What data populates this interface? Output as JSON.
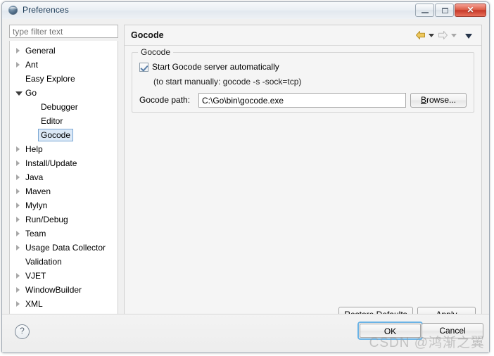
{
  "window": {
    "title": "Preferences",
    "icon": "preferences-globe-icon",
    "minimize_label": "",
    "maximize_label": "",
    "close_label": "✕"
  },
  "sidebar": {
    "filter": {
      "value": "",
      "placeholder": "type filter text"
    },
    "items": [
      {
        "label": "General",
        "level": 0,
        "expandable": true,
        "expanded": false,
        "selected": false
      },
      {
        "label": "Ant",
        "level": 0,
        "expandable": true,
        "expanded": false,
        "selected": false
      },
      {
        "label": "Easy Explore",
        "level": 0,
        "expandable": false,
        "expanded": false,
        "selected": false
      },
      {
        "label": "Go",
        "level": 0,
        "expandable": true,
        "expanded": true,
        "selected": false
      },
      {
        "label": "Debugger",
        "level": 1,
        "expandable": false,
        "expanded": false,
        "selected": false
      },
      {
        "label": "Editor",
        "level": 1,
        "expandable": false,
        "expanded": false,
        "selected": false
      },
      {
        "label": "Gocode",
        "level": 1,
        "expandable": false,
        "expanded": false,
        "selected": true
      },
      {
        "label": "Help",
        "level": 0,
        "expandable": true,
        "expanded": false,
        "selected": false
      },
      {
        "label": "Install/Update",
        "level": 0,
        "expandable": true,
        "expanded": false,
        "selected": false
      },
      {
        "label": "Java",
        "level": 0,
        "expandable": true,
        "expanded": false,
        "selected": false
      },
      {
        "label": "Maven",
        "level": 0,
        "expandable": true,
        "expanded": false,
        "selected": false
      },
      {
        "label": "Mylyn",
        "level": 0,
        "expandable": true,
        "expanded": false,
        "selected": false
      },
      {
        "label": "Run/Debug",
        "level": 0,
        "expandable": true,
        "expanded": false,
        "selected": false
      },
      {
        "label": "Team",
        "level": 0,
        "expandable": true,
        "expanded": false,
        "selected": false
      },
      {
        "label": "Usage Data Collector",
        "level": 0,
        "expandable": true,
        "expanded": false,
        "selected": false
      },
      {
        "label": "Validation",
        "level": 0,
        "expandable": false,
        "expanded": false,
        "selected": false
      },
      {
        "label": "VJET",
        "level": 0,
        "expandable": true,
        "expanded": false,
        "selected": false
      },
      {
        "label": "WindowBuilder",
        "level": 0,
        "expandable": true,
        "expanded": false,
        "selected": false
      },
      {
        "label": "XML",
        "level": 0,
        "expandable": true,
        "expanded": false,
        "selected": false
      }
    ]
  },
  "content": {
    "title": "Gocode",
    "nav": {
      "back_icon": "back-arrow-icon",
      "back_dropdown_icon": "chevron-down-icon",
      "forward_icon": "forward-arrow-icon",
      "forward_dropdown_icon": "chevron-down-icon",
      "menu_icon": "chevron-down-icon",
      "back_color": "#e8b84b",
      "forward_color": "#cfcfcf"
    },
    "group": {
      "legend": "Gocode",
      "checkbox": {
        "label": "Start Gocode server automatically",
        "checked": true
      },
      "hint": "(to start manually: gocode -s -sock=tcp)",
      "path_label": "Gocode path:",
      "path_value": "C:\\Go\\bin\\gocode.exe",
      "browse_label": "Browse..."
    },
    "restore_defaults_label": "Restore Defaults",
    "restore_defaults_mnemonic": "D",
    "apply_label": "Apply",
    "apply_mnemonic": "A"
  },
  "footer": {
    "help_icon": "question-mark-icon",
    "ok_label": "OK",
    "cancel_label": "Cancel",
    "watermark": "CSDN @鸿渐之翼"
  }
}
